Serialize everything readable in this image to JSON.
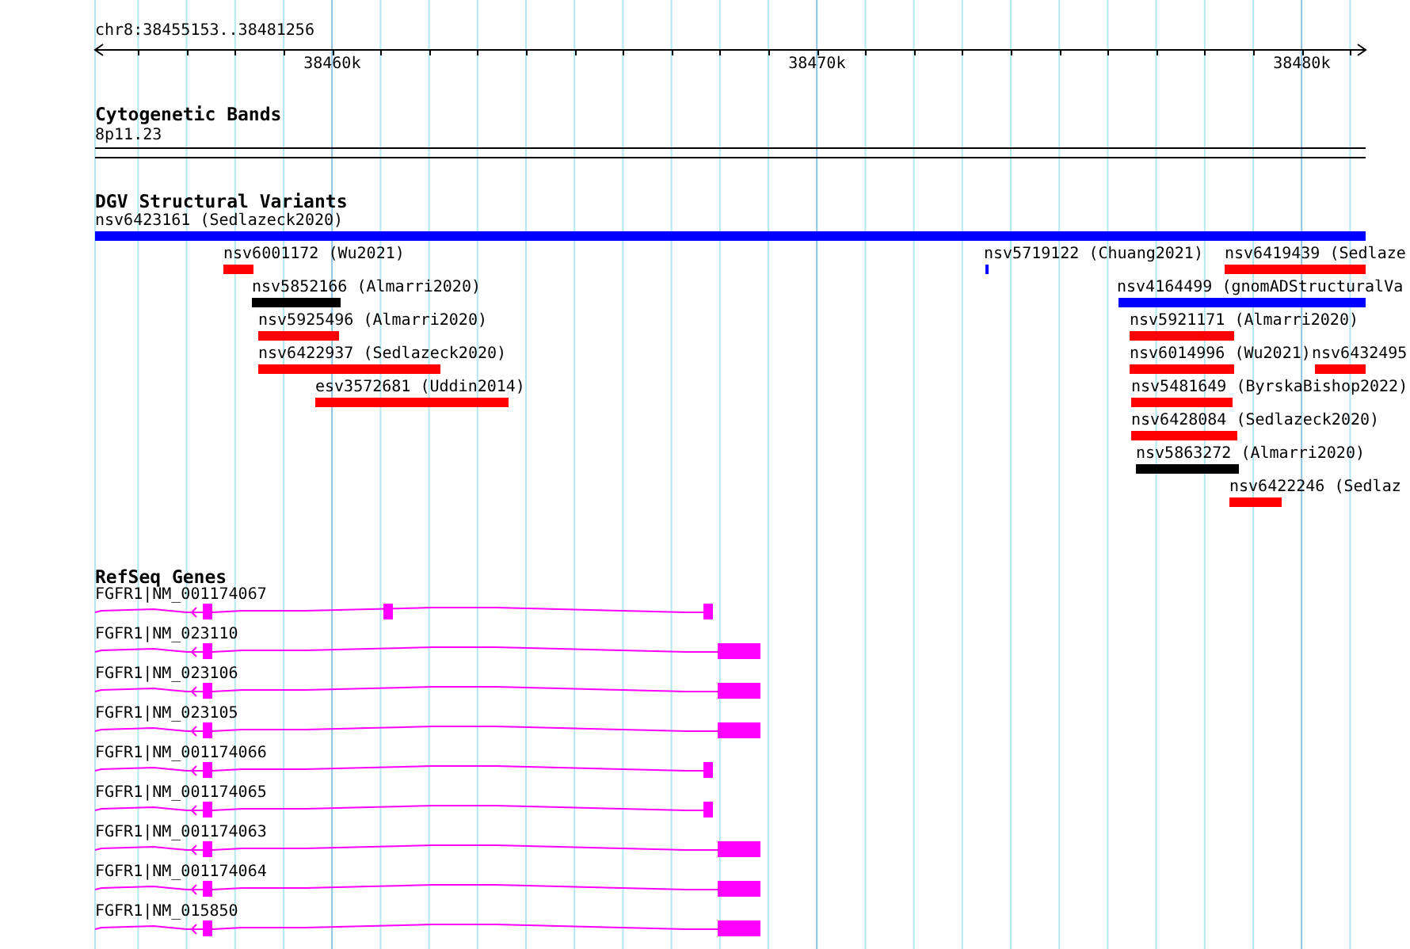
{
  "ruler": {
    "region": "chr8:38455153..38481256",
    "ticks": [
      "38460k",
      "38470k",
      "38480k"
    ]
  },
  "cytogenetic_bands": {
    "title": "Cytogenetic Bands",
    "band": "8p11.23"
  },
  "dgv": {
    "title": "DGV Structural Variants",
    "variants": [
      {
        "label": "nsv6423161 (Sedlazeck2020)",
        "color": "#0000ff"
      },
      {
        "label": "nsv6001172 (Wu2021)",
        "color": "#ff0000"
      },
      {
        "label": "nsv5719122 (Chuang2021)",
        "color": "#0000ff"
      },
      {
        "label": "nsv6419439 (Sedlaze",
        "color": "#ff0000"
      },
      {
        "label": "nsv5852166 (Almarri2020)",
        "color": "#000000"
      },
      {
        "label": "nsv4164499 (gnomADStructuralVa",
        "color": "#0000ff"
      },
      {
        "label": "nsv5925496 (Almarri2020)",
        "color": "#ff0000"
      },
      {
        "label": "nsv5921171 (Almarri2020)",
        "color": "#ff0000"
      },
      {
        "label": "nsv6422937 (Sedlazeck2020)",
        "color": "#ff0000"
      },
      {
        "label": "nsv6014996 (Wu2021)",
        "color": "#ff0000"
      },
      {
        "label": "nsv6432495",
        "color": "#ff0000"
      },
      {
        "label": "esv3572681 (Uddin2014)",
        "color": "#ff0000"
      },
      {
        "label": "nsv5481649 (ByrskaBishop2022)",
        "color": "#ff0000"
      },
      {
        "label": "nsv6428084 (Sedlazeck2020)",
        "color": "#ff0000"
      },
      {
        "label": "nsv5863272 (Almarri2020)",
        "color": "#000000"
      },
      {
        "label": "nsv6422246 (Sedlaz",
        "color": "#ff0000"
      }
    ]
  },
  "refseq": {
    "title": "RefSeq Genes",
    "genes": [
      {
        "label": "FGFR1|NM_001174067",
        "kind": "alt"
      },
      {
        "label": "FGFR1|NM_023110",
        "kind": "full"
      },
      {
        "label": "FGFR1|NM_023106",
        "kind": "full"
      },
      {
        "label": "FGFR1|NM_023105",
        "kind": "full"
      },
      {
        "label": "FGFR1|NM_001174066",
        "kind": "trunc"
      },
      {
        "label": "FGFR1|NM_001174065",
        "kind": "trunc"
      },
      {
        "label": "FGFR1|NM_001174063",
        "kind": "full"
      },
      {
        "label": "FGFR1|NM_001174064",
        "kind": "full"
      },
      {
        "label": "FGFR1|NM_015850",
        "kind": "full"
      }
    ]
  }
}
